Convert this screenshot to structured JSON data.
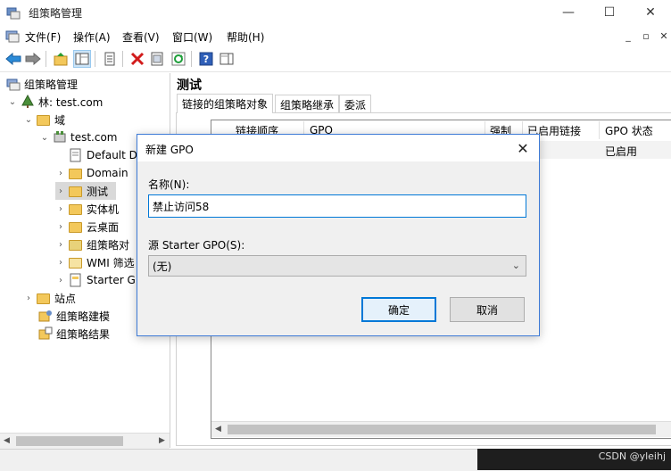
{
  "window": {
    "title": "组策略管理",
    "minimize_glyph": "—",
    "maximize_glyph": "☐",
    "close_glyph": "✕"
  },
  "menu": {
    "items": [
      "文件(F)",
      "操作(A)",
      "查看(V)",
      "窗口(W)",
      "帮助(H)"
    ],
    "mdi_minimize": "_",
    "mdi_restore": "▫",
    "mdi_close": "✕"
  },
  "toolbar": {
    "icons": [
      "back-arrow-icon",
      "forward-arrow-icon",
      "up-folder-icon",
      "show-tree-icon",
      "properties-icon",
      "delete-icon",
      "export-list-icon",
      "refresh-icon",
      "help-icon",
      "action-pane-icon"
    ]
  },
  "tree": {
    "root": "组策略管理",
    "forest": "林: test.com",
    "domains": "域",
    "domain": "test.com",
    "children": [
      "Default D",
      "Domain",
      "测试",
      "实体机",
      "云桌面",
      "组策略对",
      "WMI 筛选",
      "Starter G"
    ],
    "sites": "站点",
    "modeling": "组策略建模",
    "results": "组策略结果"
  },
  "right": {
    "title": "测试",
    "tabs": [
      "链接的组策略对象",
      "组策略继承",
      "委派"
    ],
    "columns": [
      "链接顺序",
      "GPO",
      "强制",
      "已启用链接",
      "GPO 状态"
    ],
    "row_status": "已启用"
  },
  "dialog": {
    "title": "新建 GPO",
    "name_label": "名称(N):",
    "name_value": "禁止访问58",
    "starter_label": "源 Starter GPO(S):",
    "starter_value": "(无)",
    "ok_label": "确定",
    "cancel_label": "取消"
  },
  "watermark": "CSDN @yleihj",
  "colors": {
    "accent": "#0078d7",
    "folder": "#f3c85b",
    "selection": "#d9d9d9"
  }
}
